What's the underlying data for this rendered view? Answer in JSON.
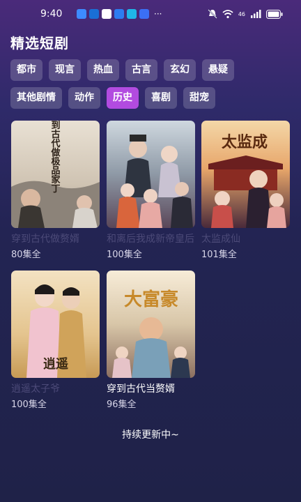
{
  "status_bar": {
    "time": "9:40",
    "notification_icons": [
      "shield-app-icon",
      "message-app-icon",
      "mail-app-icon",
      "bulb-app-icon",
      "browser-app-icon",
      "search-app-icon"
    ],
    "overflow": "···",
    "network_label": "46",
    "colors": {
      "icon_blue": "#3d8bff",
      "icon_cyan": "#1fb6e8"
    }
  },
  "page_title": "精选短剧",
  "categories": {
    "row1": [
      "都市",
      "现言",
      "热血",
      "古言",
      "玄幻",
      "悬疑"
    ],
    "row2": [
      "其他剧情",
      "动作",
      "历史",
      "喜剧",
      "甜宠"
    ],
    "selected": "历史",
    "colors": {
      "chip_bg": "#ffffff2e",
      "chip_active_bg": "#b24be0"
    }
  },
  "dramas": [
    {
      "title": "穿到古代做赘婿",
      "episodes": "80集全",
      "poster_text": "回到古代做极品家丁",
      "title_faded": true,
      "poster_icon": "ancient-wedding-poster"
    },
    {
      "title": "和离后我成新帝皇后",
      "episodes": "100集全",
      "poster_text": "",
      "title_faded": true,
      "poster_icon": "palace-romance-poster"
    },
    {
      "title": "太监成仙",
      "episodes": "101集全",
      "poster_text": "太监成",
      "title_faded": true,
      "poster_icon": "palace-eunuch-poster"
    },
    {
      "title": "逍遥太子爷",
      "episodes": "100集全",
      "poster_text": "逍遥",
      "title_faded": true,
      "poster_icon": "prince-couple-poster"
    },
    {
      "title": "穿到古代当赘婿",
      "episodes": "96集全",
      "poster_text": "大富豪",
      "title_faded": false,
      "poster_icon": "rich-man-poster"
    }
  ],
  "footer_text": "持续更新中~"
}
